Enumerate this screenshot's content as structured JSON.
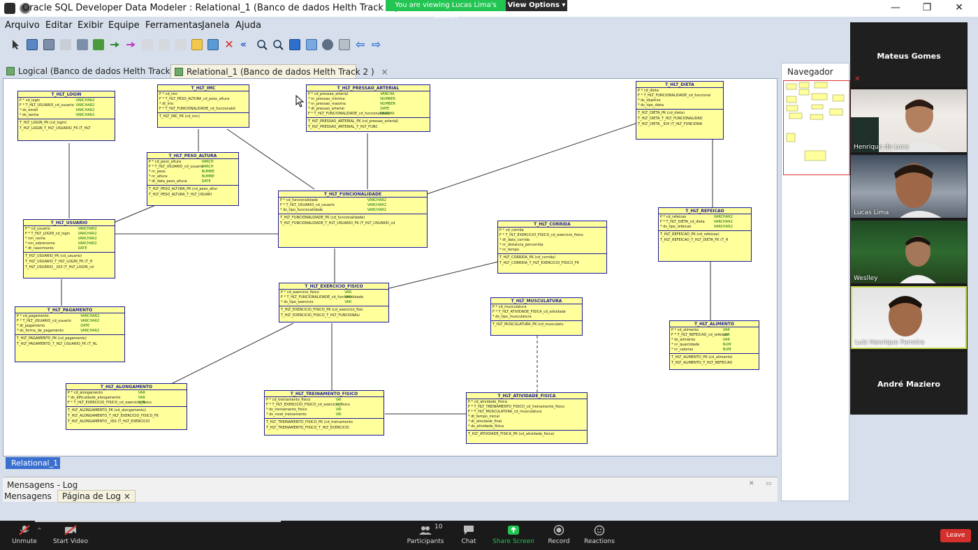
{
  "window": {
    "title": "Oracle SQL Developer Data Modeler : Relational_1 (Banco de dados Helth Track 2 )",
    "minimize": "—",
    "restore": "❐",
    "close": "✕"
  },
  "share": {
    "banner": "You are viewing Lucas Lima's screen",
    "view_options": "View Options ▾"
  },
  "menu": [
    "Arquivo",
    "Editar",
    "Exibir",
    "Equipe",
    "Ferramentas",
    "Janela",
    "Ajuda"
  ],
  "doc_tabs": [
    {
      "label": "Logical (Banco de dados Helth Track 2 )",
      "active": false
    },
    {
      "label": "Relational_1 (Banco de dados Helth Track 2 )",
      "active": true
    }
  ],
  "canvas": {
    "page_tab": "Relational_1",
    "entities": {
      "login": {
        "name": "T_HLT_LOGIN",
        "cols": [
          [
            "P  * cd_login",
            "VARCHAR2"
          ],
          [
            "F  * T_HLT_USUARIO_cd_usuario",
            "VARCHAR2"
          ],
          [
            "   * ds_email",
            "VARCHAR2"
          ],
          [
            "   * ds_senha",
            "VARCHAR2"
          ]
        ],
        "keys": [
          "T_HLT_LOGIN_PK (cd_login)",
          "T_HLT_LOGIN_T_HLT_USUARIO_FK (T_HLT"
        ]
      },
      "imc": {
        "name": "T_HLT_IMC",
        "cols": [
          [
            "P  * cd_imc",
            ""
          ],
          [
            "F  * T_HLT_PESO_ALTURA_cd_peso_altura",
            ""
          ],
          [
            "   * dt_imc",
            ""
          ],
          [
            "F  * T_HLT_FUNCIONALIDADE_cd_funcionalid",
            ""
          ]
        ],
        "keys": [
          "T_HLT_IMC_PK (cd_imc)"
        ]
      },
      "pressao": {
        "name": "T_HLT_PRESSAO_ARTERIAL",
        "cols": [
          [
            "P  * cd_pressao_arterial",
            "VARCHA"
          ],
          [
            "   * nr_pressao_minima",
            "NUMBER"
          ],
          [
            "   * nr_pressao_maxima",
            "NUMBER"
          ],
          [
            "   * dt_pressao_arterial",
            "DATE"
          ],
          [
            "F  * T_HLT_FUNCIONALIDADE_cd_funcionalidade",
            "VARCHA"
          ]
        ],
        "keys": [
          "T_HLT_PRESSAO_ARTERIAL_PK (cd_pressao_arterial)",
          "T_HLT_PRESSAO_ARTERIAL_T_HLT_FUNC"
        ]
      },
      "dieta": {
        "name": "T_HLT_DIETA",
        "cols": [
          [
            "P  * cd_dieta",
            ""
          ],
          [
            "F  * T_HLT_FUNCIONALIDADE_cd_funcional",
            ""
          ],
          [
            "   * ds_objetivo",
            ""
          ],
          [
            "   * ds_tipo_dieta",
            ""
          ]
        ],
        "keys": [
          "T_HLT_DIETA_PK (cd_dieta)",
          "T_HLT_DIETA_T_HLT_FUNCIONALIDAD",
          "T_HLT_DIETA__IDX (T_HLT_FUNCIONA"
        ]
      },
      "peso": {
        "name": "T_HLT_PESO_ALTURA",
        "cols": [
          [
            "P  * cd_peso_altura",
            "VARCH"
          ],
          [
            "F  * T_HLT_USUARIO_cd_usuario",
            "VARCH"
          ],
          [
            "   * nr_peso",
            "NUMBE"
          ],
          [
            "   * nr_altura",
            "NUMBE"
          ],
          [
            "   * dt_data_peso_altura",
            "DATE"
          ]
        ],
        "keys": [
          "T_HLT_PESO_ALTURA_PK (cd_peso_altur",
          "T_HLT_PESO_ALTURA_T_HLT_USUARI"
        ]
      },
      "func": {
        "name": "T_HLT_FUNCIONALIDADE",
        "cols": [
          [
            "P  * cd_funcionalidade",
            "VARCHAR2"
          ],
          [
            "F  * T_HLT_USUARIO_cd_usuario",
            "VARCHAR2"
          ],
          [
            "   * ds_tipo_funcionalidade",
            "VARCHAR2"
          ]
        ],
        "keys": [
          "T_HLT_FUNCIONALIDADE_PK (cd_funcionalidade)",
          "T_HLT_FUNCIONALIDADE_T_HLT_USUARIO_FK (T_HLT_USUARIO_cd"
        ]
      },
      "usuario": {
        "name": "T_HLT_USUARIO",
        "cols": [
          [
            "P  * cd_usuario",
            "VARCHAR2"
          ],
          [
            "F  * T_HLT_LOGIN_cd_login",
            "VARCHAR2"
          ],
          [
            "   * nm_nome",
            "VARCHAR2"
          ],
          [
            "   * nm_sobrenome",
            "VARCHAR2"
          ],
          [
            "   * dt_nascimento",
            "DATE"
          ]
        ],
        "keys": [
          "T_HLT_USUARIO_PK (cd_usuario)",
          "T_HLT_USUARIO_T_HLT_LOGIN_FK (T_H",
          "T_HLT_USUARIO__IDX (T_HLT_LOGIN_cd"
        ]
      },
      "corrida": {
        "name": "T_HLT_CORRIDA",
        "cols": [
          [
            "P  * cd_corrida",
            ""
          ],
          [
            "F  * T_HLT_EXERCICIO_FISICO_cd_exercicio_fisico",
            ""
          ],
          [
            "   * dt_data_corrida",
            ""
          ],
          [
            "   * nr_distancia_percorrida",
            ""
          ],
          [
            "   * nr_tempo",
            ""
          ]
        ],
        "keys": [
          "T_HLT_CORRIDA_PK (cd_corrida)",
          "T_HLT_CORRIDA_T_HLT_EXERCICIO_FISICO_FK"
        ]
      },
      "refeicao": {
        "name": "T_HLT_REFEICAO",
        "cols": [
          [
            "P  * cd_refeicao",
            "VARCHAR2"
          ],
          [
            "F  * T_HLT_DIETA_cd_dieta",
            "VARCHAR2"
          ],
          [
            "   * ds_tipo_refeicao",
            "VARCHAR2"
          ]
        ],
        "keys": [
          "T_HLT_REFEICAO_PK (cd_refeicao)",
          "T_HLT_REFEICAO_T_HLT_DIETA_FK (T_H"
        ]
      },
      "exercicio": {
        "name": "T_HLT_EXERCICIO_FISICO",
        "cols": [
          [
            "P  * cd_exercicio_fisico",
            "VAR"
          ],
          [
            "F  * T_HLT_FUNCIONALIDADE_cd_funcionalidade",
            "VAR"
          ],
          [
            "   * ds_tipo_exercicio",
            "VAR"
          ]
        ],
        "keys": [
          "T_HLT_EXERCICIO_FISICO_PK (cd_exercicio_fisic",
          "T_HLT_EXERCICIO_FISICO_T_HLT_FUNCIONALI"
        ]
      },
      "pagamento": {
        "name": "T_HLT_PAGAMENTO",
        "cols": [
          [
            "P  * cd_pagamento",
            "VARCHAR2"
          ],
          [
            "F  * T_HLT_USUARIO_cd_usuario",
            "VARCHAR2"
          ],
          [
            "   * dt_pagamento",
            "DATE"
          ],
          [
            "   * ds_forma_de_pagamento",
            "VARCHAR2"
          ]
        ],
        "keys": [
          "T_HLT_PAGAMENTO_PK (cd_pagamento)",
          "T_HLT_PAGAMENTO_T_HLT_USUARIO_FK (T_HL"
        ]
      },
      "musculatura": {
        "name": "T_HLT_MUSCULATURA",
        "cols": [
          [
            "P  * cd_musculatura",
            ""
          ],
          [
            "F  * T_HLT_ATIVIDADE_FISICA_cd_atividade",
            ""
          ],
          [
            "   * ds_tipo_musculatura",
            ""
          ]
        ],
        "keys": [
          "T_HLT_MUSCULATURA_PK (cd_musculatu"
        ]
      },
      "alimento": {
        "name": "T_HLT_ALIMENTO",
        "cols": [
          [
            "P  * cd_alimento",
            "VAR"
          ],
          [
            "F  * T_HLT_REFEICAO_cd_refeicao",
            "VAR"
          ],
          [
            "   * ds_alimento",
            "VAR"
          ],
          [
            "   * nr_quantidade",
            "NUM"
          ],
          [
            "   * nr_calorias",
            "NUM"
          ]
        ],
        "keys": [
          "T_HLT_ALIMENTO_PK (cd_alimento)",
          "T_HLT_ALIMENTO_T_HLT_REFEICAO"
        ]
      },
      "alongamento": {
        "name": "T_HLT_ALONGAMENTO",
        "cols": [
          [
            "P  * cd_alongamento",
            "VAR"
          ],
          [
            "   * ds_dificuldade_alongamento",
            "VAR"
          ],
          [
            "F  * T_HLT_EXERCICIO_FISICO_cd_exercicio_fisico",
            "VAR"
          ]
        ],
        "keys": [
          "T_HLT_ALONGAMENTO_PK (cd_alongamento)",
          "T_HLT_ALONGAMENTO_T_HLT_EXERCICIO_FISICO_FK",
          "T_HLT_ALONGAMENTO__IDX (T_HLT_EXERCICIO"
        ]
      },
      "treinamento": {
        "name": "T_HLT_TREINAMENTO_FISICO",
        "cols": [
          [
            "P  * cd_treinamento_fisico",
            "VAI"
          ],
          [
            "F  * T_HLT_EXERCICIO_FISICO_cd_exercicio_fisico",
            "VAI"
          ],
          [
            "   * ds_treinamento_fisico",
            "VAI"
          ],
          [
            "   * ds_nivel_treinamento",
            "VAI"
          ]
        ],
        "keys": [
          "T_HLT_TREINAMENTO_FISICO_PK (cd_treinamento",
          "T_HLT_TREINAMENTO_FISICO_T_HLT_EXERCICIO"
        ]
      },
      "atividade": {
        "name": "T_HLT_ATIVIDADE_FISICA",
        "cols": [
          [
            "P  * cd_atividade_fisica",
            ""
          ],
          [
            "F  * T_HLT_TREINAMENTO_FISICO_cd_treinamento_fisico",
            ""
          ],
          [
            "F  * T_HLT_MUSCULATURA_cd_musculatura",
            ""
          ],
          [
            "   * dt_tempo_inicial",
            ""
          ],
          [
            "   * dt_atividade_final",
            ""
          ],
          [
            "   * ds_atividade_fisica",
            ""
          ]
        ],
        "keys": [
          "T_HLT_ATIVIDADE_FISICA_PK (cd_atividade_fisica)"
        ]
      }
    }
  },
  "messages": {
    "title": "Mensagens - Log",
    "tab1": "Mensagens",
    "tab2": "Página de Log ×"
  },
  "navigator": {
    "title": "Navegador"
  },
  "participants": [
    {
      "name": "Mateus Gomes",
      "video": false
    },
    {
      "name": "Henrique de Luca",
      "video": true
    },
    {
      "name": "Lucas Lima",
      "video": true
    },
    {
      "name": "Weslley",
      "video": true
    },
    {
      "name": "Luiz Henrique Ferreira",
      "video": true,
      "active": true
    },
    {
      "name": "André Maziero",
      "video": false
    }
  ],
  "zoom_controls": {
    "unmute": "Unmute",
    "start_video": "Start Video",
    "participants": "Participants",
    "participants_count": "10",
    "chat": "Chat",
    "share_screen": "Share Screen",
    "record": "Record",
    "reactions": "Reactions",
    "leave": "Leave"
  },
  "colors": {
    "entity_fill": "#ffff9c",
    "entity_border": "#1a1aa0",
    "share_green": "#23c552",
    "leave_red": "#d5302c",
    "active_speaker": "#c6d94b"
  }
}
